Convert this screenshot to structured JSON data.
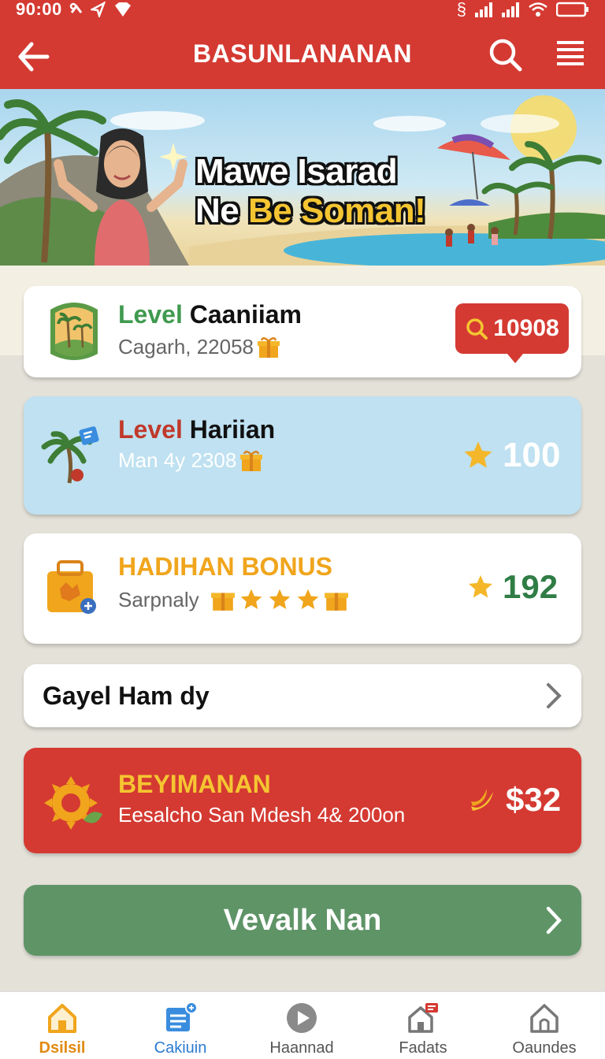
{
  "status_bar": {
    "time": "90:00",
    "extra": "§"
  },
  "app_bar": {
    "title": "BASUNLANANAN"
  },
  "banner": {
    "line1": "Mawe Isarad",
    "line2_pre": "Ne ",
    "line2_hl": "Be Soman!"
  },
  "cards": {
    "level_caaniiam": {
      "title_green": "Level",
      "title_black": "Caaniiam",
      "subtitle": "Cagarh, 22058",
      "badge_value": "10908"
    },
    "level_hariian": {
      "title_red": "Level",
      "title_black": "Hariian",
      "subtitle": "Man 4y 2308",
      "reward": "100"
    },
    "hadihan_bonus": {
      "title": "HADIHAN BONUS",
      "subtitle": "Sarpnaly",
      "reward": "192"
    },
    "gayel": {
      "title": "Gayel Ham dy"
    },
    "beyimanan": {
      "title": "BEYIMANAN",
      "subtitle": "Eesalcho San Mdesh 4& 200on",
      "reward": "$32"
    },
    "cta": {
      "label": "Vevalk Nan"
    }
  },
  "bottom_nav": {
    "items": [
      {
        "label": "Dsilsil",
        "icon": "home-icon",
        "active": true
      },
      {
        "label": "Cakiuin",
        "icon": "edit-list-icon",
        "active": true
      },
      {
        "label": "Haannad",
        "icon": "play-icon",
        "active": false
      },
      {
        "label": "Fadats",
        "icon": "house-flag-icon",
        "active": false
      },
      {
        "label": "Oaundes",
        "icon": "house-icon",
        "active": false
      }
    ]
  },
  "colors": {
    "primary_red": "#d43a32",
    "accent_green": "#5f9467",
    "level_green": "#3f9a4f",
    "bonus_orange": "#f0a51c",
    "star_gold": "#f5b72a"
  }
}
